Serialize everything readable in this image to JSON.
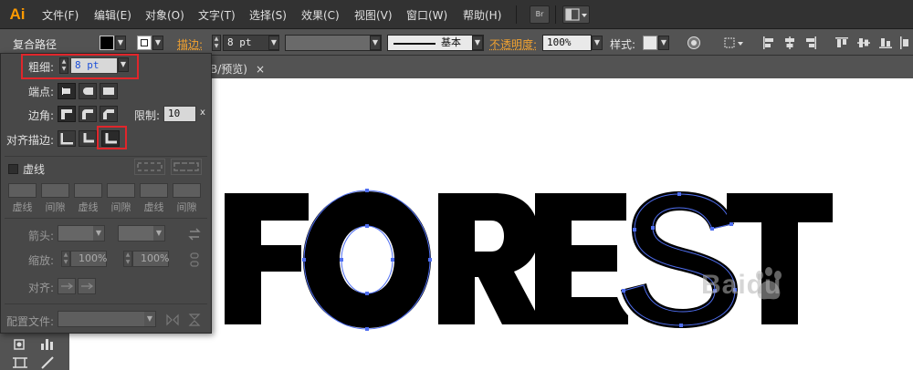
{
  "app": {
    "logo_text": "Ai",
    "accent": "#ff9a00"
  },
  "menu": [
    {
      "id": "file",
      "label": "文件(F)"
    },
    {
      "id": "edit",
      "label": "编辑(E)"
    },
    {
      "id": "object",
      "label": "对象(O)"
    },
    {
      "id": "type",
      "label": "文字(T)"
    },
    {
      "id": "select",
      "label": "选择(S)"
    },
    {
      "id": "effect",
      "label": "效果(C)"
    },
    {
      "id": "view",
      "label": "视图(V)"
    },
    {
      "id": "window",
      "label": "窗口(W)"
    },
    {
      "id": "help",
      "label": "帮助(H)"
    }
  ],
  "menubar_icons": {
    "bridge": "Br"
  },
  "control_bar": {
    "object_type": "复合路径",
    "stroke_label": "描边:",
    "stroke_weight": "8 pt",
    "profile_label": "基本",
    "opacity_label": "不透明度:",
    "opacity_value": "100%",
    "style_label": "样式:"
  },
  "document": {
    "tab_label": "B/预览)",
    "close_glyph": "×",
    "artwork_text": "FOREST"
  },
  "stroke_panel": {
    "weight_label": "粗细:",
    "weight_value": "8 pt",
    "cap_label": "端点:",
    "corner_label": "边角:",
    "limit_label": "限制:",
    "limit_value": "10",
    "limit_unit": "x",
    "align_label": "对齐描边:",
    "dashed_label": "虚线",
    "dash_labels": [
      "虚线",
      "间隙",
      "虚线",
      "间隙",
      "虚线",
      "间隙"
    ],
    "arrowhead_label": "箭头:",
    "scale_label": "缩放:",
    "scale_start": "100%",
    "scale_end": "100%",
    "arrow_align_label": "对齐:",
    "profile_label": "配置文件:",
    "highlight_color": "#e0262b"
  },
  "watermark": {
    "text": "Baidu"
  }
}
